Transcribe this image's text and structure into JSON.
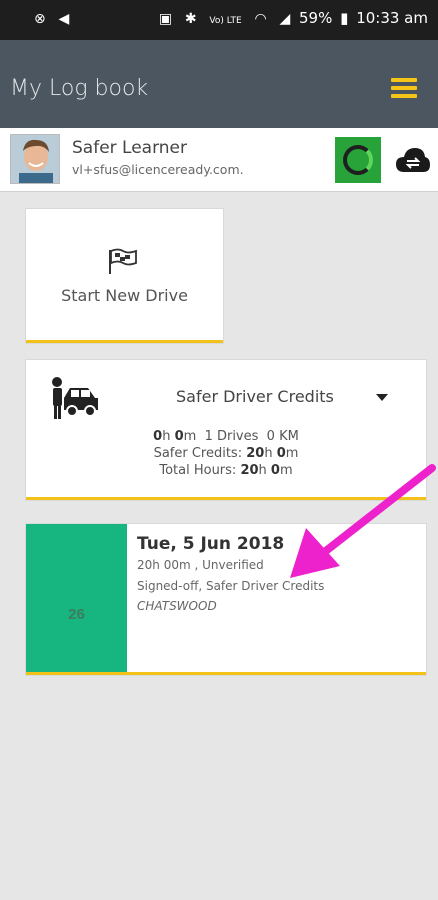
{
  "status_bar": {
    "left_icons": [
      "alarm-icon",
      "navigation-icon"
    ],
    "right_icons": [
      "nfc-icon",
      "bluetooth-icon",
      "volte-icon",
      "wifi-icon",
      "signal-icon",
      "battery-icon"
    ],
    "volte": "Vo) LTE",
    "battery": "59%",
    "time": "10:33 am"
  },
  "app_bar": {
    "title": "My Log book",
    "menu_icon": "hamburger-icon",
    "accent_color": "#f5c518"
  },
  "profile": {
    "name": "Safer Learner",
    "email": "vl+sfus@licenceready.com.",
    "sync_icon": "sync-progress-icon",
    "cloud_icon": "cloud-sync-icon"
  },
  "start_drive": {
    "icon": "flag-icon",
    "label": "Start New Drive"
  },
  "credits": {
    "icon": "driver-car-icon",
    "title": "Safer Driver Credits",
    "dropdown_icon": "caret-down-icon",
    "hours_h": "0",
    "hours_m": "0",
    "drives": "1 Drives",
    "km": "0 KM",
    "safer_credits_label": "Safer Credits:",
    "safer_credits_h": "20",
    "safer_credits_m": "0",
    "total_hours_label": "Total Hours:",
    "total_hours_h": "20",
    "total_hours_m": "0"
  },
  "entries": [
    {
      "day": "26",
      "date": "Tue, 5 Jun 2018",
      "duration_status": "20h 00m , Unverified",
      "type": "Signed-off, Safer Driver Credits",
      "location": "CHATSWOOD",
      "color": "#17b57f"
    }
  ],
  "annotation": {
    "arrow_color": "#ee22cc"
  }
}
